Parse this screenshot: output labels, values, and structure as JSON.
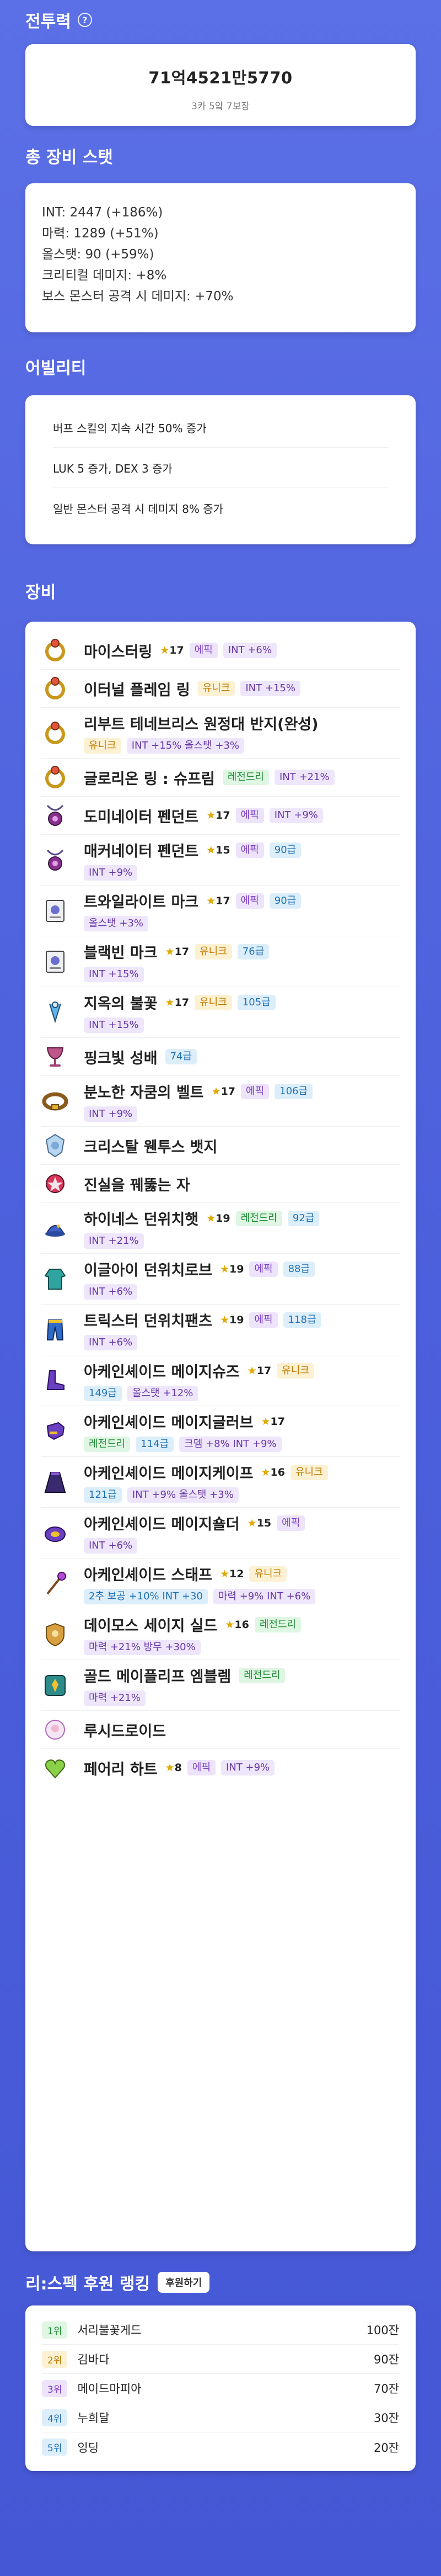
{
  "power": {
    "title": "전투력",
    "help": "?",
    "value": "71억4521만5770",
    "sub": "3카 5앜 7보장"
  },
  "stats": {
    "title": "총 장비 스탯",
    "lines": [
      "INT: 2447 (+186%)",
      "마력: 1289 (+51%)",
      "올스탯: 90 (+59%)",
      "크리티컬 데미지: +8%",
      "보스 몬스터 공격 시 데미지: +70%"
    ]
  },
  "ability": {
    "title": "어빌리티",
    "lines": [
      "버프 스킬의 지속 시간 50% 증가",
      "LUK 5 증가, DEX 3 증가",
      "일반 몬스터 공격 시 데미지 8% 증가"
    ]
  },
  "equipment": {
    "title": "장비",
    "items": [
      {
        "name": "마이스터링",
        "icon": "ring-icon",
        "star": "17",
        "tags": [
          {
            "t": "에픽",
            "c": "t-epic"
          },
          {
            "t": "INT +6%",
            "c": "t-stat"
          }
        ]
      },
      {
        "name": "이터널 플레임 링",
        "icon": "ring-icon",
        "tags": [
          {
            "t": "유니크",
            "c": "t-unique"
          },
          {
            "t": "INT +15%",
            "c": "t-stat"
          }
        ]
      },
      {
        "name": "리부트 테네브리스 원정대 반지(완성)",
        "icon": "ring-icon",
        "tags2": [
          {
            "t": "유니크",
            "c": "t-unique"
          },
          {
            "t": "INT +15% 올스탯 +3%",
            "c": "t-stat"
          }
        ]
      },
      {
        "name": "글로리온 링 : 슈프림",
        "icon": "ring-icon",
        "tags": [
          {
            "t": "레전드리",
            "c": "t-legend"
          },
          {
            "t": "INT +21%",
            "c": "t-stat"
          }
        ]
      },
      {
        "name": "도미네이터 펜던트",
        "icon": "pendant-icon",
        "star": "17",
        "tags": [
          {
            "t": "에픽",
            "c": "t-epic"
          },
          {
            "t": "INT +9%",
            "c": "t-stat"
          }
        ]
      },
      {
        "name": "매커네이터 펜던트",
        "icon": "pendant-icon",
        "star": "15",
        "tags": [
          {
            "t": "에픽",
            "c": "t-epic"
          },
          {
            "t": "90급",
            "c": "t-level"
          }
        ],
        "tags2": [
          {
            "t": "INT +9%",
            "c": "t-stat"
          }
        ]
      },
      {
        "name": "트와일라이트 마크",
        "icon": "mark-icon",
        "star": "17",
        "tags": [
          {
            "t": "에픽",
            "c": "t-epic"
          },
          {
            "t": "90급",
            "c": "t-level"
          }
        ],
        "tags2": [
          {
            "t": "올스탯 +3%",
            "c": "t-stat"
          }
        ]
      },
      {
        "name": "블랙빈 마크",
        "icon": "mark-icon",
        "star": "17",
        "tags": [
          {
            "t": "유니크",
            "c": "t-unique"
          },
          {
            "t": "76급",
            "c": "t-level"
          }
        ],
        "tags2": [
          {
            "t": "INT +15%",
            "c": "t-stat"
          }
        ]
      },
      {
        "name": "지옥의 불꽃",
        "icon": "earring-icon",
        "star": "17",
        "tags": [
          {
            "t": "유니크",
            "c": "t-unique"
          },
          {
            "t": "105급",
            "c": "t-level"
          }
        ],
        "tags2": [
          {
            "t": "INT +15%",
            "c": "t-stat"
          }
        ]
      },
      {
        "name": "핑크빛 성배",
        "icon": "chalice-icon",
        "tags": [
          {
            "t": "74급",
            "c": "t-level"
          }
        ]
      },
      {
        "name": "분노한 자쿰의 벨트",
        "icon": "belt-icon",
        "star": "17",
        "tags": [
          {
            "t": "에픽",
            "c": "t-epic"
          },
          {
            "t": "106급",
            "c": "t-level"
          }
        ],
        "tags2": [
          {
            "t": "INT +9%",
            "c": "t-stat"
          }
        ]
      },
      {
        "name": "크리스탈 웬투스 뱃지",
        "icon": "badge-icon"
      },
      {
        "name": "진실을 꿰뚫는 자",
        "icon": "medal-icon"
      },
      {
        "name": "하이네스 던위치햇",
        "icon": "hat-icon",
        "star": "19",
        "tags": [
          {
            "t": "레전드리",
            "c": "t-legend"
          },
          {
            "t": "92급",
            "c": "t-level"
          }
        ],
        "tags2": [
          {
            "t": "INT +21%",
            "c": "t-stat"
          }
        ]
      },
      {
        "name": "이글아이 던위치로브",
        "icon": "top-icon",
        "star": "19",
        "tags": [
          {
            "t": "에픽",
            "c": "t-epic"
          },
          {
            "t": "88급",
            "c": "t-level"
          }
        ],
        "tags2": [
          {
            "t": "INT +6%",
            "c": "t-stat"
          }
        ]
      },
      {
        "name": "트릭스터 던위치팬츠",
        "icon": "pants-icon",
        "star": "19",
        "tags": [
          {
            "t": "에픽",
            "c": "t-epic"
          },
          {
            "t": "118급",
            "c": "t-level"
          }
        ],
        "tags2": [
          {
            "t": "INT +6%",
            "c": "t-stat"
          }
        ]
      },
      {
        "name": "아케인셰이드 메이지슈즈",
        "icon": "shoes-icon",
        "star": "17",
        "tags": [
          {
            "t": "유니크",
            "c": "t-unique"
          }
        ],
        "tags2": [
          {
            "t": "149급",
            "c": "t-level"
          },
          {
            "t": "올스탯 +12%",
            "c": "t-stat"
          }
        ]
      },
      {
        "name": "아케인셰이드 메이지글러브",
        "icon": "glove-icon",
        "star": "17",
        "tags2": [
          {
            "t": "레전드리",
            "c": "t-legend"
          },
          {
            "t": "114급",
            "c": "t-level"
          },
          {
            "t": "크뎀 +8% INT +9%",
            "c": "t-stat"
          }
        ]
      },
      {
        "name": "아케인셰이드 메이지케이프",
        "icon": "cape-icon",
        "star": "16",
        "tags": [
          {
            "t": "유니크",
            "c": "t-unique"
          }
        ],
        "tags2": [
          {
            "t": "121급",
            "c": "t-level"
          },
          {
            "t": "INT +9% 올스탯 +3%",
            "c": "t-stat"
          }
        ]
      },
      {
        "name": "아케인셰이드 메이지숄더",
        "icon": "shoulder-icon",
        "star": "15",
        "tags": [
          {
            "t": "에픽",
            "c": "t-epic"
          }
        ],
        "tags2": [
          {
            "t": "INT +6%",
            "c": "t-stat"
          }
        ]
      },
      {
        "name": "아케인셰이드 스태프",
        "icon": "staff-icon",
        "star": "12",
        "tags": [
          {
            "t": "유니크",
            "c": "t-unique"
          }
        ],
        "tags2": [
          {
            "t": "2추 보공 +10% INT +30",
            "c": "t-level"
          },
          {
            "t": "마력 +9% INT +6%",
            "c": "t-stat"
          }
        ]
      },
      {
        "name": "데이모스 세이지 실드",
        "icon": "shield-icon",
        "star": "16",
        "tags": [
          {
            "t": "레전드리",
            "c": "t-legend"
          }
        ],
        "tags2": [
          {
            "t": "마력 +21% 방무 +30%",
            "c": "t-stat"
          }
        ]
      },
      {
        "name": "골드 메이플리프 엠블렘",
        "icon": "emblem-icon",
        "tags": [
          {
            "t": "레전드리",
            "c": "t-legend"
          }
        ],
        "tags2": [
          {
            "t": "마력 +21%",
            "c": "t-stat"
          }
        ]
      },
      {
        "name": "루시드로이드",
        "icon": "android-icon"
      },
      {
        "name": "페어리 하트",
        "icon": "heart-icon",
        "star": "8",
        "tags": [
          {
            "t": "에픽",
            "c": "t-epic"
          },
          {
            "t": "INT +9%",
            "c": "t-stat"
          }
        ]
      }
    ]
  },
  "ranking": {
    "title": "리:스펙 후원 랭킹",
    "button": "후원하기",
    "rows": [
      {
        "rank": "1위",
        "name": "서리불꽃게드",
        "amount": "100잔"
      },
      {
        "rank": "2위",
        "name": "김바다",
        "amount": "90잔"
      },
      {
        "rank": "3위",
        "name": "메이드마피아",
        "amount": "70잔"
      },
      {
        "rank": "4위",
        "name": "누희달",
        "amount": "30잔"
      },
      {
        "rank": "5위",
        "name": "잉딩",
        "amount": "20잔"
      }
    ]
  },
  "colors": {
    "background": "#5b6fe6",
    "star": "#e0a800"
  }
}
